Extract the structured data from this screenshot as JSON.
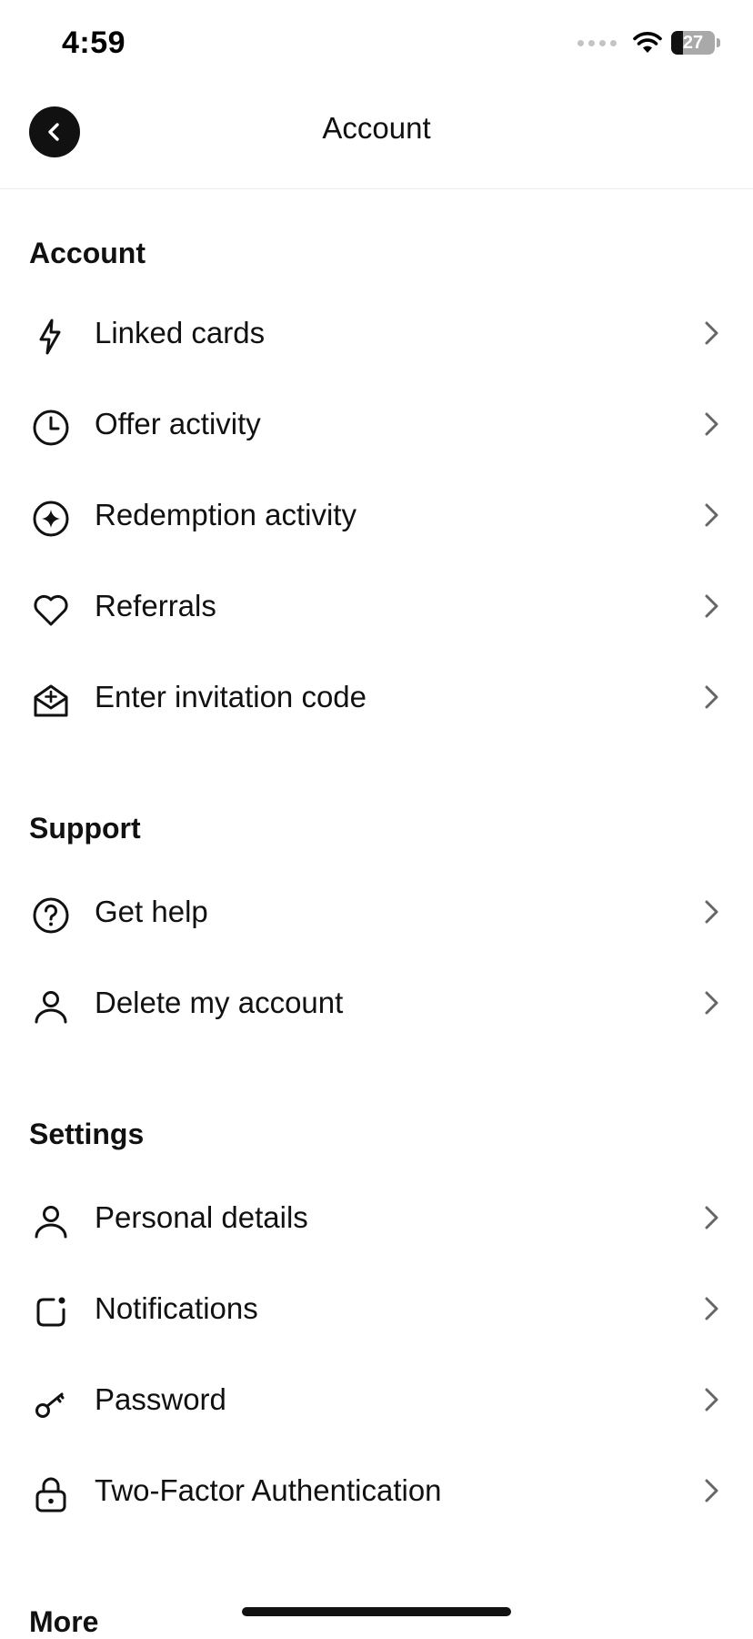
{
  "status_bar": {
    "time": "4:59",
    "battery_level": "27"
  },
  "header": {
    "title": "Account"
  },
  "sections": [
    {
      "title": "Account",
      "items": [
        {
          "label": "Linked cards",
          "icon": "bolt-icon"
        },
        {
          "label": "Offer activity",
          "icon": "clock-icon"
        },
        {
          "label": "Redemption activity",
          "icon": "sparkle-circle-icon"
        },
        {
          "label": "Referrals",
          "icon": "heart-icon"
        },
        {
          "label": "Enter invitation code",
          "icon": "open-envelope-icon"
        }
      ]
    },
    {
      "title": "Support",
      "items": [
        {
          "label": "Get help",
          "icon": "question-circle-icon"
        },
        {
          "label": "Delete my account",
          "icon": "person-icon"
        }
      ]
    },
    {
      "title": "Settings",
      "items": [
        {
          "label": "Personal details",
          "icon": "person-icon"
        },
        {
          "label": "Notifications",
          "icon": "notification-badge-icon"
        },
        {
          "label": "Password",
          "icon": "key-icon"
        },
        {
          "label": "Two-Factor Authentication",
          "icon": "lock-icon"
        }
      ]
    },
    {
      "title": "More",
      "items": []
    }
  ]
}
